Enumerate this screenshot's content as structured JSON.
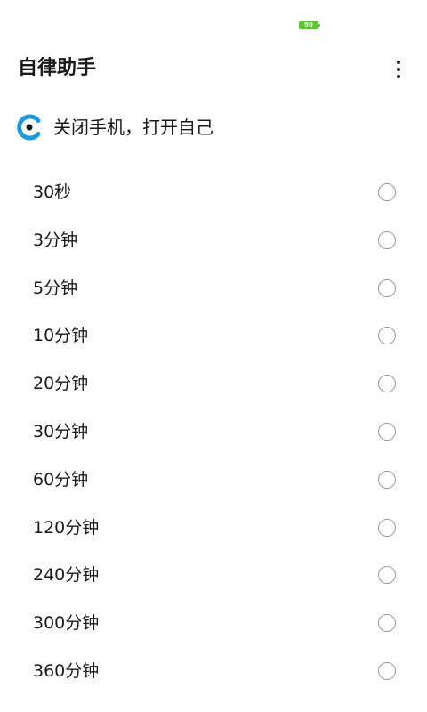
{
  "status_bar": {
    "battery_level": "90",
    "battery_color": "#5cc335"
  },
  "app_bar": {
    "title": "自律助手",
    "menu_icon": "more-vertical-icon"
  },
  "app_header": {
    "logo_icon": "app-logo-icon",
    "logo_color": "#1e9bdc",
    "slogan": "关闭手机，打开自己"
  },
  "options": [
    {
      "label": "30秒",
      "selected": false
    },
    {
      "label": "3分钟",
      "selected": false
    },
    {
      "label": "5分钟",
      "selected": false
    },
    {
      "label": "10分钟",
      "selected": false
    },
    {
      "label": "20分钟",
      "selected": false
    },
    {
      "label": "30分钟",
      "selected": false
    },
    {
      "label": "60分钟",
      "selected": false
    },
    {
      "label": "120分钟",
      "selected": false
    },
    {
      "label": "240分钟",
      "selected": false
    },
    {
      "label": "300分钟",
      "selected": false
    },
    {
      "label": "360分钟",
      "selected": false
    }
  ]
}
